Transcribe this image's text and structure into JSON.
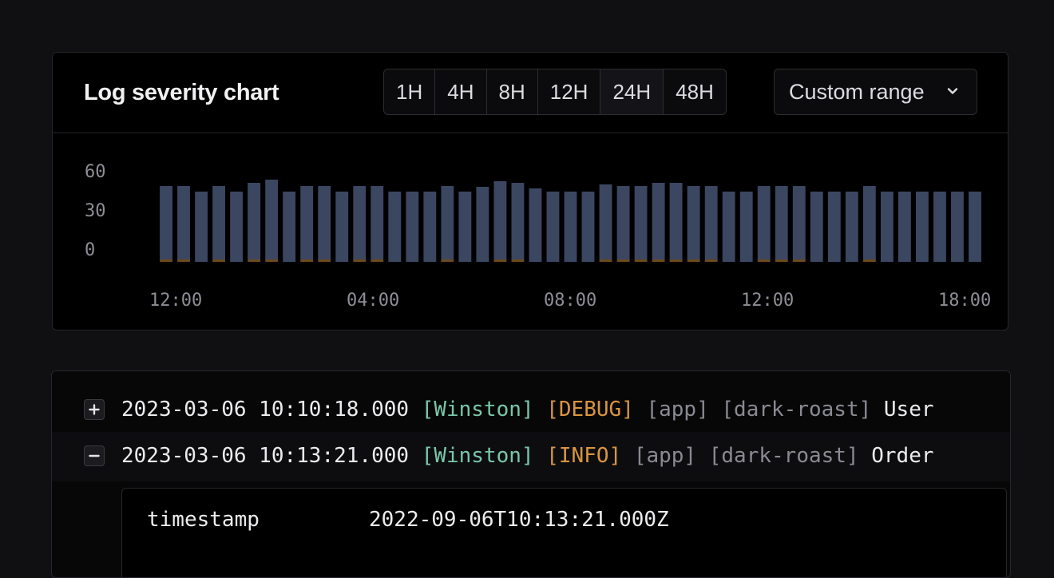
{
  "chart_card": {
    "title": "Log severity chart",
    "ranges": [
      "1H",
      "4H",
      "8H",
      "12H",
      "24H",
      "48H"
    ],
    "active_range": "24H",
    "custom_range_label": "Custom range"
  },
  "chart_data": {
    "type": "bar",
    "title": "Log severity chart",
    "y_ticks": [
      "60",
      "30",
      "0"
    ],
    "x_ticks": [
      "12:00",
      "04:00",
      "08:00",
      "12:00",
      "18:00"
    ],
    "series": [
      {
        "values": [
          46,
          46,
          44,
          46,
          44,
          48,
          50,
          44,
          46,
          46,
          44,
          46,
          46,
          44,
          44,
          44,
          46,
          44,
          47,
          49,
          48,
          46,
          44,
          44,
          44,
          47,
          46,
          46,
          48,
          48,
          46,
          46,
          44,
          44,
          46,
          46,
          46,
          44,
          44,
          44,
          46,
          44,
          44,
          44,
          44,
          44,
          44
        ]
      },
      {
        "values": [
          1,
          1,
          0,
          1,
          0,
          1,
          1,
          0,
          1,
          1,
          0,
          1,
          1,
          0,
          0,
          0,
          1,
          0,
          0,
          1,
          1,
          0,
          0,
          0,
          0,
          1,
          1,
          1,
          1,
          1,
          1,
          1,
          0,
          0,
          1,
          1,
          1,
          0,
          0,
          0,
          1,
          0,
          0,
          0,
          0,
          0,
          0
        ]
      }
    ],
    "colors": [
      "#3b4660",
      "#6a4a1c"
    ],
    "ylim": [
      0,
      60
    ]
  },
  "logs": [
    {
      "toggle_symbol": "+",
      "time": "2023-03-06 10:10:18.000",
      "source": "[Winston]",
      "level": "[DEBUG]",
      "tag1": "[app]",
      "tag2": "[dark-roast]",
      "message": "User"
    },
    {
      "toggle_symbol": "−",
      "time": "2023-03-06 10:13:21.000",
      "source": "[Winston]",
      "level": "[INFO]",
      "tag1": "[app]",
      "tag2": "[dark-roast]",
      "message": "Order"
    }
  ],
  "detail": {
    "key": "timestamp",
    "value": "2022-09-06T10:13:21.000Z"
  }
}
